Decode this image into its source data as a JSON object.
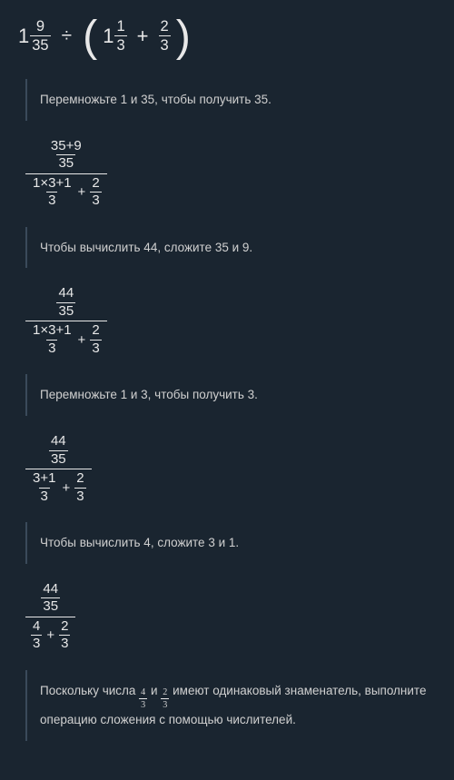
{
  "main": {
    "whole1": "1",
    "frac1_num": "9",
    "frac1_den": "35",
    "divide": "÷",
    "lparen": "(",
    "whole2": "1",
    "frac2_num": "1",
    "frac2_den": "3",
    "plus": "+",
    "frac3_num": "2",
    "frac3_den": "3",
    "rparen": ")"
  },
  "step1_text": "Перемножьте 1 и 35, чтобы получить 35.",
  "expr1": {
    "top_num": "35+9",
    "top_den": "35",
    "bot_left_num": "1×3+1",
    "bot_left_den": "3",
    "plus": "+",
    "bot_right_num": "2",
    "bot_right_den": "3"
  },
  "step2_text": "Чтобы вычислить 44, сложите 35 и 9.",
  "expr2": {
    "top_num": "44",
    "top_den": "35",
    "bot_left_num": "1×3+1",
    "bot_left_den": "3",
    "plus": "+",
    "bot_right_num": "2",
    "bot_right_den": "3"
  },
  "step3_text": "Перемножьте 1 и 3, чтобы получить 3.",
  "expr3": {
    "top_num": "44",
    "top_den": "35",
    "bot_left_num": "3+1",
    "bot_left_den": "3",
    "plus": "+",
    "bot_right_num": "2",
    "bot_right_den": "3"
  },
  "step4_text": "Чтобы вычислить 4, сложите 3 и 1.",
  "expr4": {
    "top_num": "44",
    "top_den": "35",
    "bot_left_num": "4",
    "bot_left_den": "3",
    "plus": "+",
    "bot_right_num": "2",
    "bot_right_den": "3"
  },
  "step5": {
    "prefix": "Поскольку числа ",
    "f1_num": "4",
    "f1_den": "3",
    "mid1": " и ",
    "f2_num": "2",
    "f2_den": "3",
    "suffix": " имеют одинаковый знаменатель, выполните операцию сложения с помощью числителей."
  }
}
